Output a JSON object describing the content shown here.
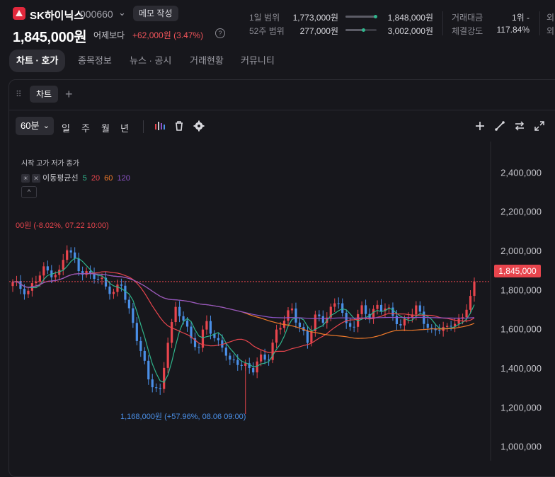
{
  "header": {
    "stock_name": "SK하이닉스",
    "stock_code": "000660",
    "memo_label": "메모 작성",
    "price": "1,845,000원",
    "compare_label": "어제보다",
    "change": "+62,000원 (3.47%)",
    "info_icon": "?"
  },
  "ranges": [
    {
      "label": "1일 범위",
      "low": "1,773,000원",
      "high": "1,848,000원",
      "position": 0.96
    },
    {
      "label": "52주 범위",
      "low": "277,000원",
      "high": "3,002,000원",
      "position": 0.57
    }
  ],
  "stats": [
    {
      "label": "거래대금",
      "value": "1위 -"
    },
    {
      "label": "체결강도",
      "value": "117.84%"
    }
  ],
  "stats_cut": [
    "외",
    "외"
  ],
  "tabs": [
    {
      "label": "차트 · 호가",
      "active": true
    },
    {
      "label": "종목정보",
      "active": false
    },
    {
      "label": "뉴스 · 공시",
      "active": false
    },
    {
      "label": "거래현황",
      "active": false
    },
    {
      "label": "커뮤니티",
      "active": false
    }
  ],
  "chart_tab": {
    "label": "차트",
    "add": "+"
  },
  "toolbar": {
    "interval": "60분",
    "periods": [
      "일",
      "주",
      "월",
      "년"
    ],
    "icons": [
      "indicator-bars-icon",
      "trash-icon",
      "settings-icon",
      "crosshair-plus-icon",
      "draw-line-icon",
      "compare-arrows-icon",
      "expand-icon"
    ]
  },
  "indicators": {
    "ohlc_label": "시작 고가 저가 종가",
    "ma_label": "이동평균선",
    "ma_periods": [
      {
        "label": "5",
        "color": "#2fb58c"
      },
      {
        "label": "20",
        "color": "#e8454d"
      },
      {
        "label": "60",
        "color": "#f07a2a"
      },
      {
        "label": "120",
        "color": "#8e55c9"
      }
    ],
    "collapse": "^"
  },
  "colors": {
    "up": "#e8454d",
    "down": "#4a8fe7",
    "ma5": "#2fb58c",
    "ma20": "#e8454d",
    "ma60": "#f07a2a",
    "ma120": "#8e55c9"
  },
  "chart_data": {
    "type": "candlestick",
    "interval": "60분",
    "y_ticks": [
      "2,400,000",
      "2,200,000",
      "2,000,000",
      "1,800,000",
      "1,600,000",
      "1,400,000",
      "1,200,000",
      "1,000,000"
    ],
    "ylim": [
      930000,
      2560000
    ],
    "current_price": 1845000,
    "current_price_label": "1,845,000",
    "high_annotation": "00원 (-8.02%, 07.22 10:00)",
    "high_value": 2010000,
    "low_annotation": "1,168,000원 (+57.96%, 08.06 09:00)",
    "low_value": 1168000,
    "close_path": [
      [
        0,
        1830000
      ],
      [
        4,
        1800000
      ],
      [
        8,
        1900000
      ],
      [
        12,
        1890000
      ],
      [
        14,
        2010000
      ],
      [
        17,
        1920000
      ],
      [
        20,
        1870000
      ],
      [
        23,
        1850000
      ],
      [
        26,
        1790000
      ],
      [
        28,
        1820000
      ],
      [
        30,
        1700000
      ],
      [
        33,
        1500000
      ],
      [
        35,
        1330000
      ],
      [
        38,
        1290000
      ],
      [
        40,
        1550000
      ],
      [
        42,
        1690000
      ],
      [
        44,
        1660000
      ],
      [
        46,
        1560000
      ],
      [
        48,
        1500000
      ],
      [
        50,
        1640000
      ],
      [
        52,
        1560000
      ],
      [
        54,
        1520000
      ],
      [
        56,
        1420000
      ],
      [
        58,
        1440000
      ],
      [
        60,
        1420000
      ],
      [
        62,
        1390000
      ],
      [
        64,
        1450000
      ],
      [
        66,
        1470000
      ],
      [
        68,
        1590000
      ],
      [
        70,
        1640000
      ],
      [
        72,
        1710000
      ],
      [
        74,
        1620000
      ],
      [
        76,
        1530000
      ],
      [
        78,
        1660000
      ],
      [
        80,
        1660000
      ],
      [
        82,
        1700000
      ],
      [
        84,
        1740000
      ],
      [
        86,
        1620000
      ],
      [
        88,
        1640000
      ],
      [
        90,
        1700000
      ],
      [
        92,
        1660000
      ],
      [
        94,
        1730000
      ],
      [
        96,
        1710000
      ],
      [
        98,
        1660000
      ],
      [
        100,
        1620000
      ],
      [
        102,
        1680000
      ],
      [
        104,
        1700000
      ],
      [
        106,
        1640000
      ],
      [
        108,
        1600000
      ],
      [
        110,
        1610000
      ],
      [
        112,
        1590000
      ],
      [
        114,
        1650000
      ],
      [
        116,
        1660000
      ],
      [
        118,
        1770000
      ],
      [
        119,
        1845000
      ]
    ]
  }
}
